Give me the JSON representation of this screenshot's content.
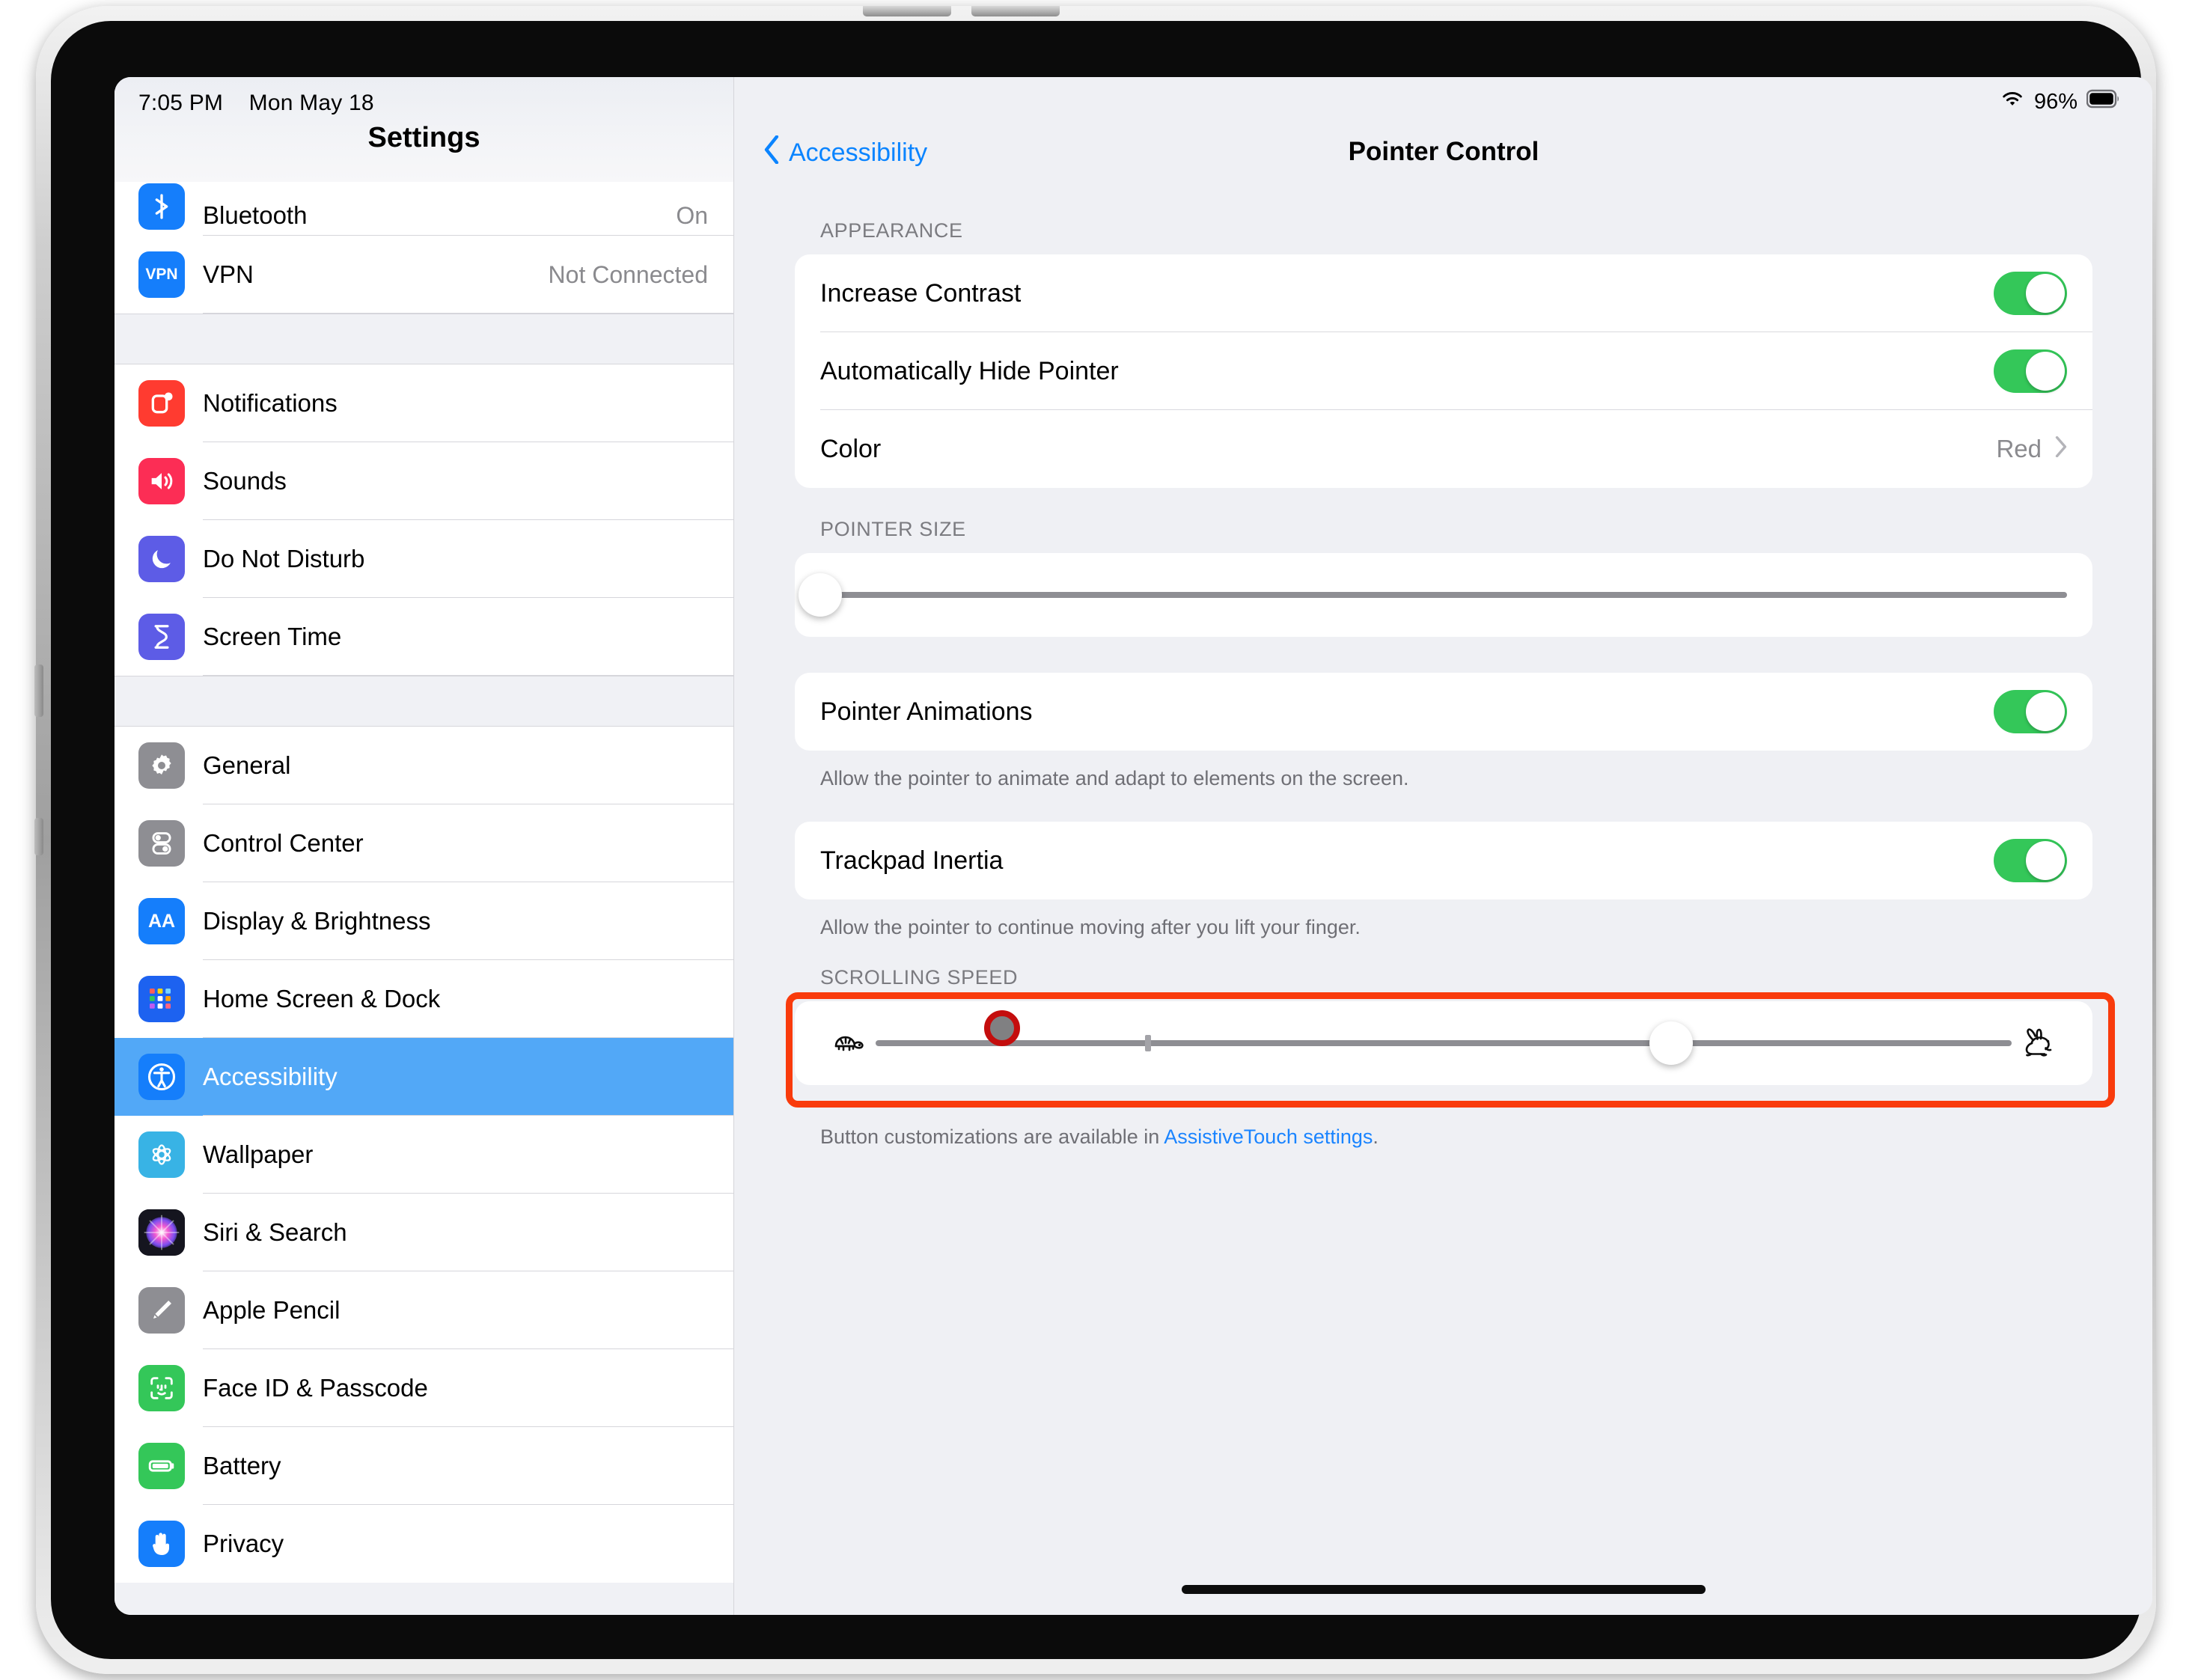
{
  "status_bar": {
    "time": "7:05 PM",
    "date": "Mon May 18",
    "battery_percent": "96%",
    "wifi_icon": "wifi-icon",
    "battery_icon": "battery-icon"
  },
  "sidebar": {
    "title": "Settings",
    "groups": [
      {
        "items": [
          {
            "label": "Bluetooth",
            "value": "On",
            "icon": "bluetooth-icon",
            "color": "#157efb",
            "selected": false,
            "clipped": true
          },
          {
            "label": "VPN",
            "value": "Not Connected",
            "icon": "vpn-icon",
            "color": "#157efb",
            "selected": false
          }
        ]
      },
      {
        "items": [
          {
            "label": "Notifications",
            "value": "",
            "icon": "notifications-icon",
            "color": "#ff3b30",
            "selected": false
          },
          {
            "label": "Sounds",
            "value": "",
            "icon": "sounds-icon",
            "color": "#fc2d55",
            "selected": false
          },
          {
            "label": "Do Not Disturb",
            "value": "",
            "icon": "do-not-disturb-icon",
            "color": "#5d5ce6",
            "selected": false
          },
          {
            "label": "Screen Time",
            "value": "",
            "icon": "screen-time-icon",
            "color": "#5d5ce6",
            "selected": false
          }
        ]
      },
      {
        "items": [
          {
            "label": "General",
            "value": "",
            "icon": "gear-icon",
            "color": "#8e8e93",
            "selected": false
          },
          {
            "label": "Control Center",
            "value": "",
            "icon": "control-center-icon",
            "color": "#8e8e93",
            "selected": false
          },
          {
            "label": "Display & Brightness",
            "value": "",
            "icon": "display-brightness-icon",
            "color": "#157efb",
            "selected": false
          },
          {
            "label": "Home Screen & Dock",
            "value": "",
            "icon": "home-screen-dock-icon",
            "color": "#1d62f0",
            "selected": false
          },
          {
            "label": "Accessibility",
            "value": "",
            "icon": "accessibility-icon",
            "color": "#157efb",
            "selected": true
          },
          {
            "label": "Wallpaper",
            "value": "",
            "icon": "wallpaper-icon",
            "color": "#38b3e5",
            "selected": false
          },
          {
            "label": "Siri & Search",
            "value": "",
            "icon": "siri-search-icon",
            "color": "#1c1c26",
            "selected": false
          },
          {
            "label": "Apple Pencil",
            "value": "",
            "icon": "apple-pencil-icon",
            "color": "#8e8e93",
            "selected": false
          },
          {
            "label": "Face ID & Passcode",
            "value": "",
            "icon": "face-id-icon",
            "color": "#34c759",
            "selected": false
          },
          {
            "label": "Battery",
            "value": "",
            "icon": "battery-settings-icon",
            "color": "#34c759",
            "selected": false
          },
          {
            "label": "Privacy",
            "value": "",
            "icon": "privacy-icon",
            "color": "#157efb",
            "selected": false
          }
        ]
      }
    ]
  },
  "detail": {
    "back_label": "Accessibility",
    "title": "Pointer Control",
    "appearance": {
      "header": "APPEARANCE",
      "increase_contrast": {
        "label": "Increase Contrast",
        "on": true
      },
      "auto_hide_pointer": {
        "label": "Automatically Hide Pointer",
        "on": true
      },
      "color": {
        "label": "Color",
        "value": "Red"
      }
    },
    "pointer_size": {
      "header": "POINTER SIZE",
      "value_percent": 0
    },
    "pointer_animations": {
      "label": "Pointer Animations",
      "on": true,
      "footnote": "Allow the pointer to animate and adapt to elements on the screen."
    },
    "trackpad_inertia": {
      "label": "Trackpad Inertia",
      "on": true,
      "footnote": "Allow the pointer to continue moving after you lift your finger."
    },
    "scrolling_speed": {
      "header": "SCROLLING SPEED",
      "left_icon": "turtle-icon",
      "right_icon": "rabbit-icon",
      "value_percent": 70,
      "tick_percent": 24,
      "highlighted": true,
      "highlight_color": "#f93b0c"
    },
    "footer": {
      "text_before": "Button customizations are available in ",
      "link": "AssistiveTouch settings",
      "text_after": "."
    }
  },
  "pointer": {
    "fill": "#808082",
    "ring": "#c40d0d"
  }
}
